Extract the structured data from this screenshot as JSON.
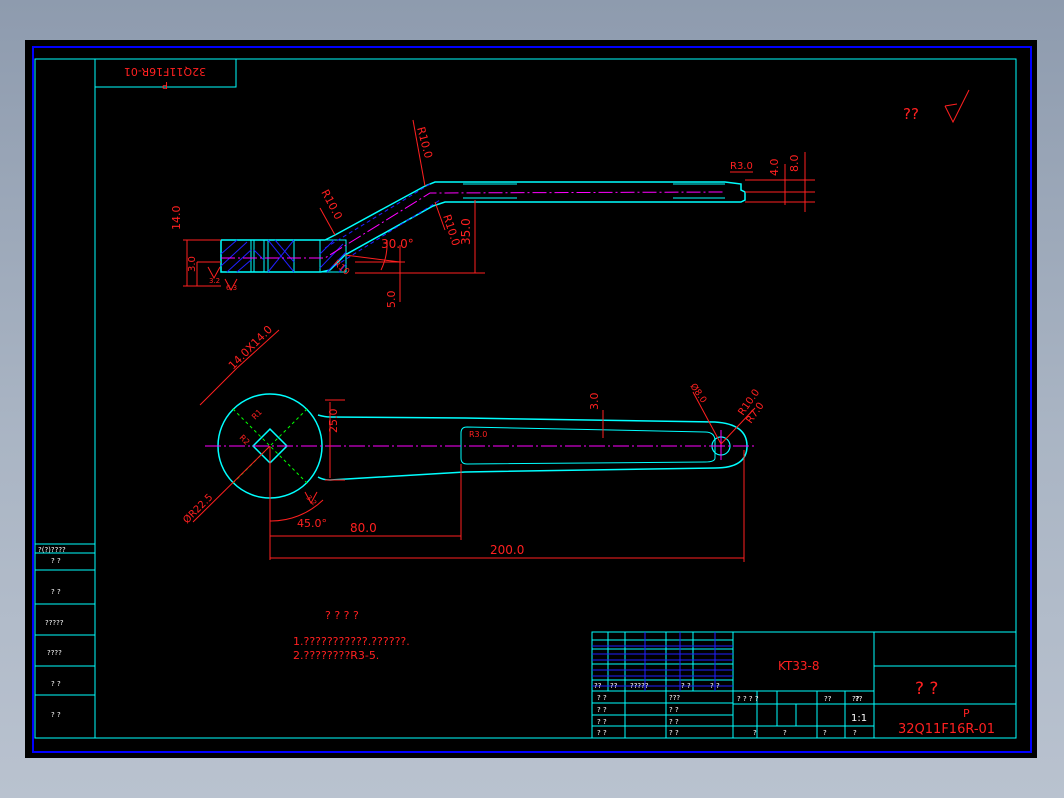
{
  "colors": {
    "background": "#000000",
    "frame": "#00ffff",
    "dimension": "#ff2020",
    "centerline": "#ff00ff",
    "hatch": "#0000ff",
    "table_text": "#ffffff"
  },
  "upper_left_box": {
    "text_flipped": "32Q11F16R-01",
    "letter": "P"
  },
  "top_right": {
    "symbol_text": "??"
  },
  "side_view": {
    "dims": {
      "h14": "14.0",
      "h3": "3.0",
      "r10_top": "R10.0",
      "r10_left": "R10.0",
      "r10_mid": "R10.0",
      "r10_low": "R10",
      "angle": "30.0°",
      "d35": "35.0",
      "d5": "5.0",
      "r3": "R3.0",
      "d4": "4.0",
      "d8": "8.0",
      "rough1": "3.2",
      "rough2": "6.3"
    }
  },
  "plan_view": {
    "dims": {
      "square": "14.0X14.0",
      "d25": "25.0",
      "d3": "3.0",
      "r3": "R3.0",
      "d8": "Ø8.0",
      "r10": "R10.0",
      "r7": "R7.0",
      "r225": "ØR22.5",
      "angle": "45.0°",
      "d80": "80.0",
      "d200": "200.0",
      "small1": "R1",
      "small2": "R2",
      "rough": "3.2"
    }
  },
  "notes": {
    "title": "? ? ? ?",
    "line1": "1.???????????.??????.",
    "line2": "2.????????R3-5."
  },
  "left_strip": {
    "header": "?(?)????",
    "rows": [
      "?  ?",
      "?  ?",
      "?????",
      "????",
      "?  ?",
      "?  ?"
    ]
  },
  "title_block": {
    "code": "KT33-8",
    "material": "?   ?",
    "letter": "P",
    "drawing_no": "32Q11F16R-01",
    "scale": "1:1",
    "hdr_cells": [
      "??",
      "??",
      "?????",
      "? ?",
      "? ?"
    ],
    "sign_cells": [
      "? ?",
      "? ?",
      "? ?",
      "? ?"
    ],
    "mid_cells": [
      "???",
      "? ?",
      "? ?",
      "? ?"
    ],
    "stage_cells": [
      "? ? ? ?",
      "??",
      "??",
      "??"
    ],
    "bottom_cells": [
      "?",
      "?",
      "?",
      "?"
    ]
  }
}
